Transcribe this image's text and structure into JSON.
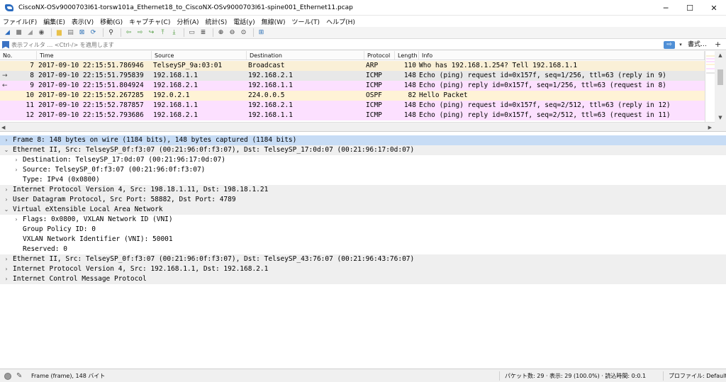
{
  "window": {
    "title": "CiscoNX-OSv9000703I61-torsw101a_Ethernet18_to_CiscoNX-OSv9000703I61-spine001_Ethernet11.pcap",
    "minimize": "─",
    "maximize": "☐",
    "close": "✕"
  },
  "menu": [
    "ファイル(F)",
    "編集(E)",
    "表示(V)",
    "移動(G)",
    "キャプチャ(C)",
    "分析(A)",
    "統計(S)",
    "電話(y)",
    "無線(W)",
    "ツール(T)",
    "ヘルプ(H)"
  ],
  "toolbar": {
    "icons": [
      {
        "name": "shark-fin-start-icon",
        "glyph": "◢",
        "color": "#2a6bbf"
      },
      {
        "name": "stop-capture-icon",
        "glyph": "■",
        "color": "#888888"
      },
      {
        "name": "restart-capture-icon",
        "glyph": "◢",
        "color": "#9a9a9a"
      },
      {
        "name": "capture-options-icon",
        "glyph": "◉",
        "color": "#555555"
      },
      {
        "name": "open-file-icon",
        "glyph": "▆",
        "color": "#e8c14a"
      },
      {
        "name": "save-file-icon",
        "glyph": "▤",
        "color": "#777777"
      },
      {
        "name": "close-file-icon",
        "glyph": "⊠",
        "color": "#2b6fb5"
      },
      {
        "name": "reload-file-icon",
        "glyph": "⟳",
        "color": "#2b6fb5"
      },
      {
        "name": "find-packet-icon",
        "glyph": "⚲",
        "color": "#333333"
      },
      {
        "name": "go-back-icon",
        "glyph": "⇦",
        "color": "#4a9a3a"
      },
      {
        "name": "go-forward-icon",
        "glyph": "⇨",
        "color": "#4a9a3a"
      },
      {
        "name": "go-to-packet-icon",
        "glyph": "↪",
        "color": "#4a9a3a"
      },
      {
        "name": "go-first-icon",
        "glyph": "⤒",
        "color": "#4a9a3a"
      },
      {
        "name": "go-last-icon",
        "glyph": "⤓",
        "color": "#4a9a3a"
      },
      {
        "name": "autoscroll-icon",
        "glyph": "▭",
        "color": "#555555"
      },
      {
        "name": "colorize-icon",
        "glyph": "≣",
        "color": "#333333"
      },
      {
        "name": "zoom-in-icon",
        "glyph": "⊕",
        "color": "#333333"
      },
      {
        "name": "zoom-out-icon",
        "glyph": "⊖",
        "color": "#333333"
      },
      {
        "name": "zoom-normal-icon",
        "glyph": "⊙",
        "color": "#333333"
      },
      {
        "name": "resize-columns-icon",
        "glyph": "⊞",
        "color": "#2b6fb5"
      }
    ]
  },
  "filter": {
    "placeholder": "表示フィルタ … <Ctrl-/> を適用します",
    "apply": "⇨",
    "dropdown": "▾",
    "expression_label": "書式…",
    "add": "+"
  },
  "packet_list": {
    "columns": [
      "No.",
      "Time",
      "Source",
      "Destination",
      "Protocol",
      "Length",
      "Info"
    ],
    "rows": [
      {
        "no": "7",
        "time": "2017-09-10 22:15:51.786946",
        "src": "TelseySP_9a:03:01",
        "dst": "Broadcast",
        "proto": "ARP",
        "len": "110",
        "info": "Who has 192.168.1.254? Tell 192.168.1.1",
        "bg": "#faf0d7",
        "rel": ""
      },
      {
        "no": "8",
        "time": "2017-09-10 22:15:51.795839",
        "src": "192.168.1.1",
        "dst": "192.168.2.1",
        "proto": "ICMP",
        "len": "148",
        "info": "Echo (ping) request  id=0x157f, seq=1/256, ttl=63 (reply in 9)",
        "bg": "#e8e8e8",
        "rel": "→"
      },
      {
        "no": "9",
        "time": "2017-09-10 22:15:51.804924",
        "src": "192.168.2.1",
        "dst": "192.168.1.1",
        "proto": "ICMP",
        "len": "148",
        "info": "Echo (ping) reply    id=0x157f, seq=1/256, ttl=63 (request in 8)",
        "bg": "#fce0ff",
        "rel": "←"
      },
      {
        "no": "10",
        "time": "2017-09-10 22:15:52.267285",
        "src": "192.0.2.1",
        "dst": "224.0.0.5",
        "proto": "OSPF",
        "len": "82",
        "info": "Hello Packet",
        "bg": "#fff3d6",
        "rel": ""
      },
      {
        "no": "11",
        "time": "2017-09-10 22:15:52.787857",
        "src": "192.168.1.1",
        "dst": "192.168.2.1",
        "proto": "ICMP",
        "len": "148",
        "info": "Echo (ping) request  id=0x157f, seq=2/512, ttl=63 (reply in 12)",
        "bg": "#fce0ff",
        "rel": ""
      },
      {
        "no": "12",
        "time": "2017-09-10 22:15:52.793686",
        "src": "192.168.2.1",
        "dst": "192.168.1.1",
        "proto": "ICMP",
        "len": "148",
        "info": "Echo (ping) reply    id=0x157f, seq=2/512, ttl=63 (request in 11)",
        "bg": "#fce0ff",
        "rel": ""
      }
    ]
  },
  "details": [
    {
      "indent": 0,
      "exp": "›",
      "text": "Frame 8: 148 bytes on wire (1184 bits), 148 bytes captured (1184 bits)",
      "bg": "#c7dcf5"
    },
    {
      "indent": 0,
      "exp": "⌄",
      "text": "Ethernet II, Src: TelseySP_0f:f3:07 (00:21:96:0f:f3:07), Dst: TelseySP_17:0d:07 (00:21:96:17:0d:07)",
      "bg": "#efefef"
    },
    {
      "indent": 1,
      "exp": "›",
      "text": "Destination: TelseySP_17:0d:07 (00:21:96:17:0d:07)",
      "bg": "#ffffff"
    },
    {
      "indent": 1,
      "exp": "›",
      "text": "Source: TelseySP_0f:f3:07 (00:21:96:0f:f3:07)",
      "bg": "#ffffff"
    },
    {
      "indent": 1,
      "exp": "",
      "text": "Type: IPv4 (0x0800)",
      "bg": "#ffffff"
    },
    {
      "indent": 0,
      "exp": "›",
      "text": "Internet Protocol Version 4, Src: 198.18.1.11, Dst: 198.18.1.21",
      "bg": "#efefef"
    },
    {
      "indent": 0,
      "exp": "›",
      "text": "User Datagram Protocol, Src Port: 58882, Dst Port: 4789",
      "bg": "#efefef"
    },
    {
      "indent": 0,
      "exp": "⌄",
      "text": "Virtual eXtensible Local Area Network",
      "bg": "#efefef"
    },
    {
      "indent": 1,
      "exp": "›",
      "text": "Flags: 0x0800, VXLAN Network ID (VNI)",
      "bg": "#ffffff"
    },
    {
      "indent": 1,
      "exp": "",
      "text": "Group Policy ID: 0",
      "bg": "#ffffff"
    },
    {
      "indent": 1,
      "exp": "",
      "text": "VXLAN Network Identifier (VNI): 50001",
      "bg": "#ffffff"
    },
    {
      "indent": 1,
      "exp": "",
      "text": "Reserved: 0",
      "bg": "#ffffff"
    },
    {
      "indent": 0,
      "exp": "›",
      "text": "Ethernet II, Src: TelseySP_0f:f3:07 (00:21:96:0f:f3:07), Dst: TelseySP_43:76:07 (00:21:96:43:76:07)",
      "bg": "#efefef"
    },
    {
      "indent": 0,
      "exp": "›",
      "text": "Internet Protocol Version 4, Src: 192.168.1.1, Dst: 192.168.2.1",
      "bg": "#efefef"
    },
    {
      "indent": 0,
      "exp": "›",
      "text": "Internet Control Message Protocol",
      "bg": "#efefef"
    }
  ],
  "status": {
    "left": "Frame (frame), 148 バイト",
    "mid": "パケット数: 29 · 表示: 29 (100.0%) · 読込時間: 0:0.1",
    "right": "プロファイル: Default"
  }
}
